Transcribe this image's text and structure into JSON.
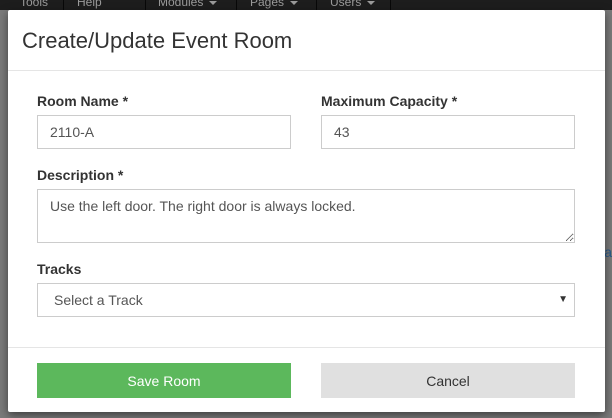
{
  "background": {
    "nav_items": [
      {
        "label": "Tools",
        "has_caret": false
      },
      {
        "label": "Help",
        "has_caret": false
      },
      {
        "label": "Modules",
        "has_caret": true
      },
      {
        "label": "Pages",
        "has_caret": true
      },
      {
        "label": "Users",
        "has_caret": true
      }
    ],
    "right_link_fragment": "a"
  },
  "modal": {
    "title": "Create/Update Event Room",
    "fields": {
      "room_name": {
        "label": "Room Name *",
        "value": "2110-A"
      },
      "max_capacity": {
        "label": "Maximum Capacity *",
        "value": "43"
      },
      "description": {
        "label": "Description *",
        "value": "Use the left door. The right door is always locked."
      },
      "tracks": {
        "label": "Tracks",
        "selected": "Select a Track",
        "arrow": "▼"
      }
    },
    "buttons": {
      "save": "Save Room",
      "cancel": "Cancel"
    }
  },
  "colors": {
    "save_button": "#5cb85c",
    "cancel_button": "#e0e0e0",
    "navbar": "#1d1d1d"
  }
}
